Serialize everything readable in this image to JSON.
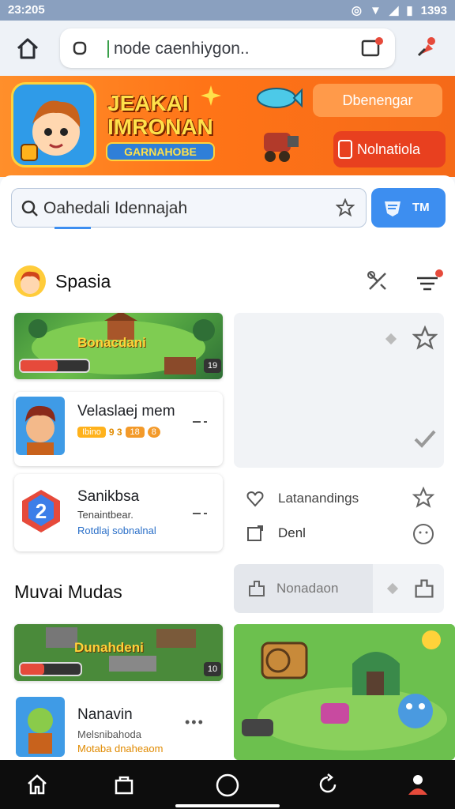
{
  "status": {
    "time": "23:205",
    "right_text": "1393"
  },
  "browser": {
    "url": "node caenhiygon..",
    "icons": [
      "home-icon",
      "lock-icon",
      "tabs-icon",
      "menu-icon"
    ]
  },
  "banner": {
    "title_line1": "JEAKAI",
    "title_line2": "IMRONAN",
    "subtitle": "GARNAHOBE",
    "button1": "Dbenengar",
    "button2": "Nolnatiola"
  },
  "search": {
    "text": "Oahedali Idennajah",
    "button": "TM"
  },
  "section1": {
    "title": "Spasia"
  },
  "items": [
    {
      "banner_label": "Bonacdani",
      "badge": "19"
    },
    {
      "title": "Velaslaej mem",
      "badges": [
        "Ibino",
        "9 3",
        "18",
        "8"
      ]
    },
    {
      "title": "Sanikbsa",
      "line1": "Tenaintbear.",
      "line2": "Rotdlaj sobnalnal"
    }
  ],
  "side": {
    "row1": "Latanandings",
    "row2": "Denl",
    "row3": "Nonadaon"
  },
  "section2": {
    "title": "Muvai Mudas"
  },
  "items2": [
    {
      "banner_label": "Dunahdeni",
      "badge": "10"
    },
    {
      "title": "Nanavin",
      "line1": "Melsnibahoda",
      "line2": "Motaba dnaheaom"
    }
  ],
  "colors": {
    "accent": "#3d8ef0",
    "banner": "#ff7a1a",
    "badge_red": "#e64a3b"
  }
}
